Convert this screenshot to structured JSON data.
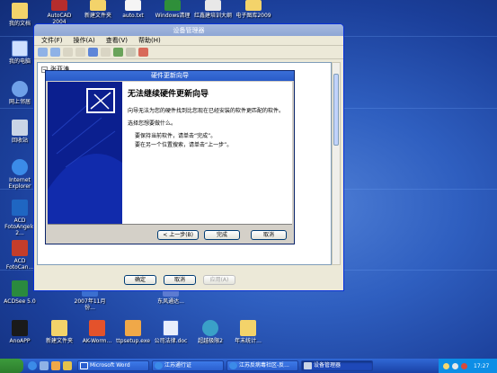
{
  "desktop": {
    "icons": [
      {
        "label": "我的文档"
      },
      {
        "label": "我的电脑"
      },
      {
        "label": "网上邻居"
      },
      {
        "label": "回收站"
      },
      {
        "label": "Internet Explorer"
      },
      {
        "label": "ACD FotoAngelo 2..."
      },
      {
        "label": "ACD FotoCan..."
      },
      {
        "label": "ACDSee 5.0"
      },
      {
        "label": "AutoCAD 2004"
      },
      {
        "label": "新建文件夹"
      },
      {
        "label": "auto.txt"
      },
      {
        "label": "Windows清理"
      },
      {
        "label": "红鑫建培训大纲"
      },
      {
        "label": "电子图库2009"
      },
      {
        "label": "新建文件夹"
      },
      {
        "label": "AK-Worm..."
      },
      {
        "label": "ttpsetup.exe"
      },
      {
        "label": "公司法律.doc"
      },
      {
        "label": "超越极限2"
      },
      {
        "label": "2007年11月份..."
      },
      {
        "label": "东风通达..."
      },
      {
        "label": "AnoAPP"
      },
      {
        "label": "年末统计..."
      }
    ]
  },
  "device_manager": {
    "title": "设备管理器",
    "menu": [
      "文件(F)",
      "操作(A)",
      "查看(V)",
      "帮助(H)"
    ],
    "root_node": "张亚涛",
    "buttons": {
      "ok": "确定",
      "cancel": "取消",
      "apply": "应用(A)"
    }
  },
  "wizard": {
    "title": "硬件更新向导",
    "heading": "无法继续硬件更新向导",
    "p1": "向导无法为您的硬件找到比您现在已经安装的软件更匹配的软件。",
    "p2": "选择您想要做什么。",
    "opt1": "要保持当前软件，请单击“完成”。",
    "opt2": "要在另一个位置搜索，请单击“上一步”。",
    "buttons": {
      "back": "< 上一步(B)",
      "finish": "完成",
      "cancel": "取消"
    }
  },
  "taskbar": {
    "tasks": [
      {
        "label": "Microsoft Word"
      },
      {
        "label": "江苏通行证"
      },
      {
        "label": "江苏反病毒社区-反..."
      },
      {
        "label": "设备管理器"
      }
    ],
    "clock": "17:27"
  }
}
